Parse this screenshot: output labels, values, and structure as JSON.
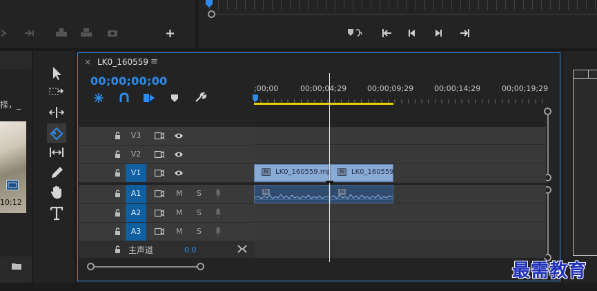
{
  "sequence": {
    "tab_title": "LK0_160559",
    "menu_glyph": "≡",
    "close_glyph": "×",
    "timecode": "00;00;00;00"
  },
  "ruler": {
    "labels": [
      ";00;00",
      "00;00;04;29",
      "00;00;09;29",
      "00;00;14;29",
      "00;00;19;29"
    ]
  },
  "tracks": {
    "video": [
      {
        "label": "V3",
        "target": false
      },
      {
        "label": "V2",
        "target": false
      },
      {
        "label": "V1",
        "target": true
      }
    ],
    "audio": [
      {
        "label": "A1",
        "target": true,
        "m": "M",
        "s": "S"
      },
      {
        "label": "A2",
        "target": true,
        "m": "M",
        "s": "S"
      },
      {
        "label": "A3",
        "target": true,
        "m": "M",
        "s": "S"
      }
    ],
    "master": {
      "label": "主声道",
      "value": "0.0"
    }
  },
  "clips": {
    "video": [
      {
        "name": "LK0_160559.mp",
        "fx": "fx"
      },
      {
        "name": "LK0_160559.",
        "fx": "fx"
      }
    ],
    "audio": [
      {
        "fx": "fx"
      },
      {
        "fx": "fx"
      }
    ]
  },
  "left_panel": {
    "partial_text": "择，_",
    "thumb_time": "10;12"
  },
  "watermark": {
    "text": "最需教育"
  },
  "colors": {
    "accent": "#2d8ceb",
    "playhead_bar": "#e6d200",
    "clip_video": "#8aaad6",
    "clip_audio": "#2f4b6e",
    "track_target": "#0f5fa1"
  }
}
